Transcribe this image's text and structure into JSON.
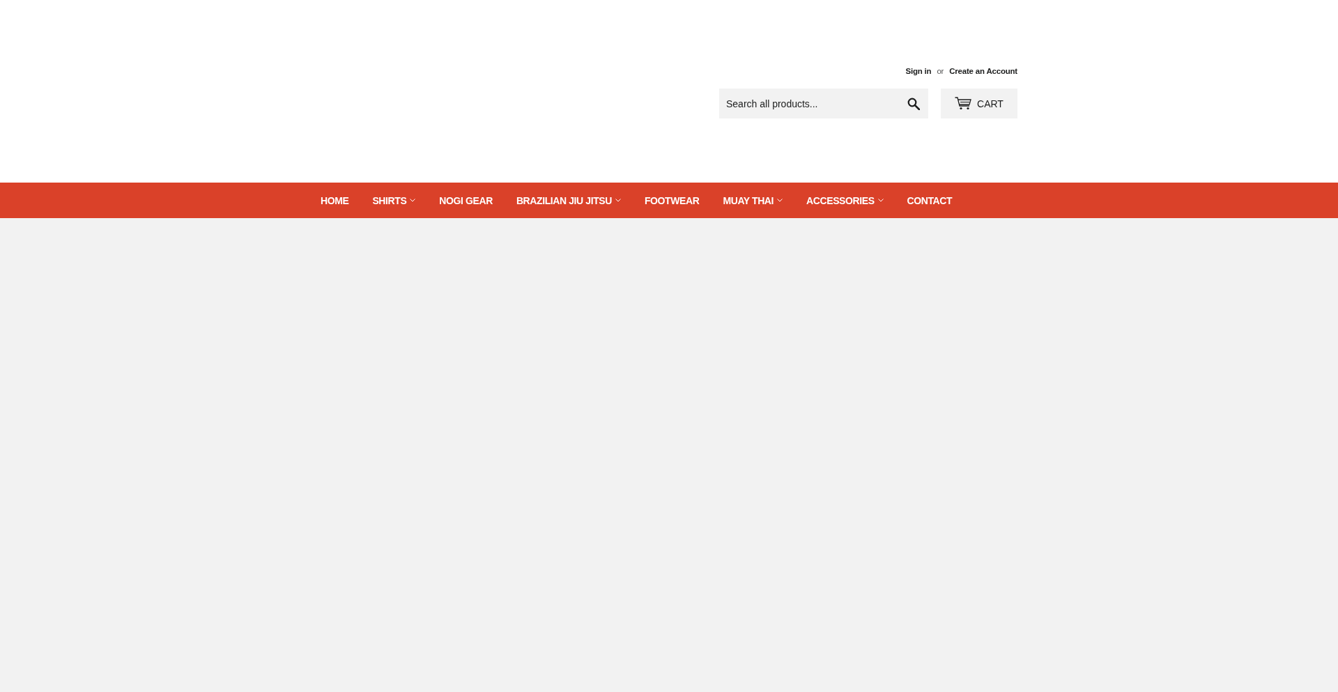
{
  "header": {
    "account_links": {
      "sign_in": "Sign in",
      "separator": "or",
      "create_account": "Create an Account"
    },
    "search": {
      "placeholder": "Search all products..."
    },
    "cart": {
      "label": "CART"
    }
  },
  "nav": {
    "items": [
      {
        "label": "HOME",
        "dropdown": false
      },
      {
        "label": "SHIRTS",
        "dropdown": true
      },
      {
        "label": "NOGI GEAR",
        "dropdown": false
      },
      {
        "label": "BRAZILIAN JIU JITSU",
        "dropdown": true
      },
      {
        "label": "FOOTWEAR",
        "dropdown": false
      },
      {
        "label": "MUAY THAI",
        "dropdown": true
      },
      {
        "label": "ACCESSORIES",
        "dropdown": true
      },
      {
        "label": "CONTACT",
        "dropdown": false
      }
    ]
  }
}
